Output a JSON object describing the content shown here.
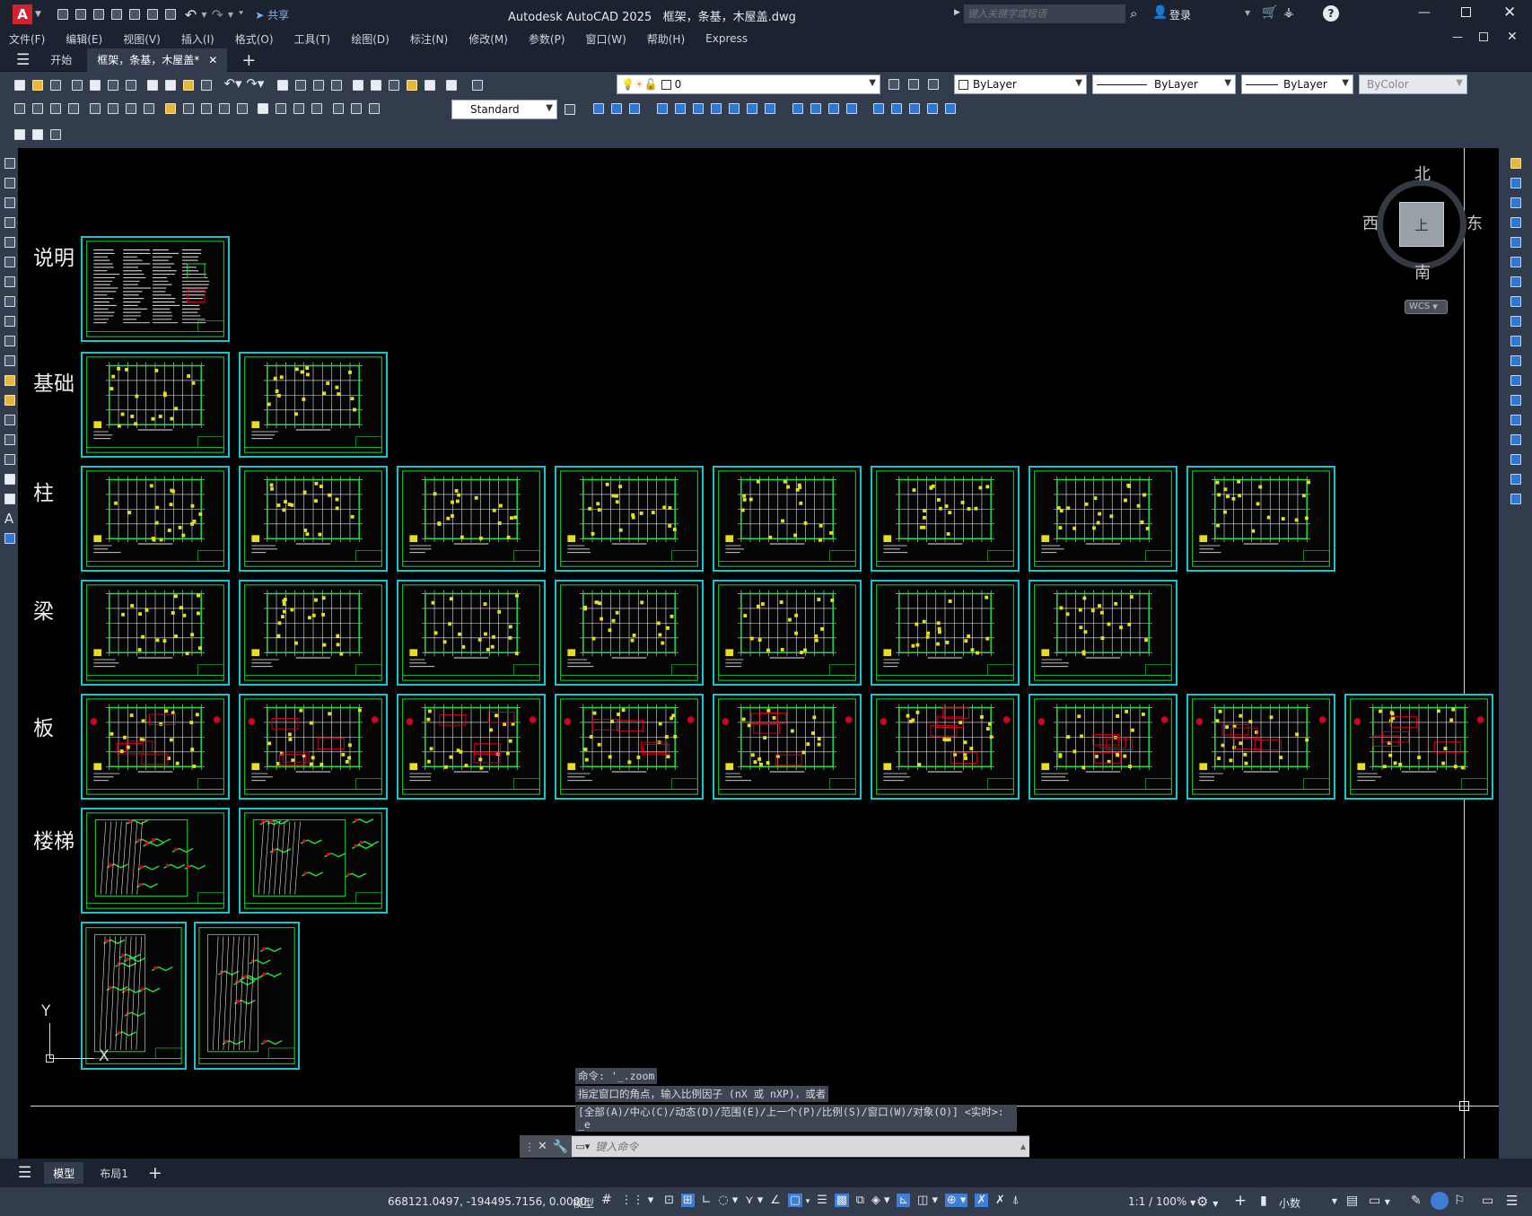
{
  "app": {
    "logo": "A",
    "title": "Autodesk AutoCAD 2025",
    "file": "框架，条基，木屋盖.dwg",
    "share": "共享",
    "search_placeholder": "键入关键字或短语",
    "login": "登录"
  },
  "menu": [
    "文件(F)",
    "编辑(E)",
    "视图(V)",
    "插入(I)",
    "格式(O)",
    "工具(T)",
    "绘图(D)",
    "标注(N)",
    "修改(M)",
    "参数(P)",
    "窗口(W)",
    "帮助(H)",
    "Express"
  ],
  "tabs": {
    "start": "开始",
    "doc": "框架，条基，木屋盖*"
  },
  "toolbar": {
    "layer": "0",
    "color": "ByLayer",
    "linetype": "ByLayer",
    "lineweight": "ByLayer",
    "plotstyle": "ByColor",
    "textstyle": "Standard"
  },
  "viewcube": {
    "north": "北",
    "south": "南",
    "east": "东",
    "west": "西",
    "face": "上",
    "ucs": "WCS"
  },
  "rows": [
    "说明",
    "基础",
    "柱",
    "梁",
    "板",
    "楼梯"
  ],
  "ucs_icon": {
    "x": "X",
    "y": "Y"
  },
  "command": {
    "history": [
      "命令: '_.zoom",
      "指定窗口的角点，输入比例因子 (nX 或 nXP)，或者",
      "[全部(A)/中心(C)/动态(D)/范围(E)/上一个(P)/比例(S)/窗口(W)/对象(O)] <实时>: _e"
    ],
    "placeholder": "键入命令"
  },
  "layout_tabs": {
    "model": "模型",
    "layout1": "布局1"
  },
  "status": {
    "coords": "668121.0497, -194495.7156, 0.0000",
    "model": "模型",
    "scale": "1:1 / 100%",
    "units": "小数"
  },
  "colors": {
    "sheet_border": "#13c7cf",
    "drawing_green": "#1fdc3e",
    "accent_red": "#d0021b"
  }
}
